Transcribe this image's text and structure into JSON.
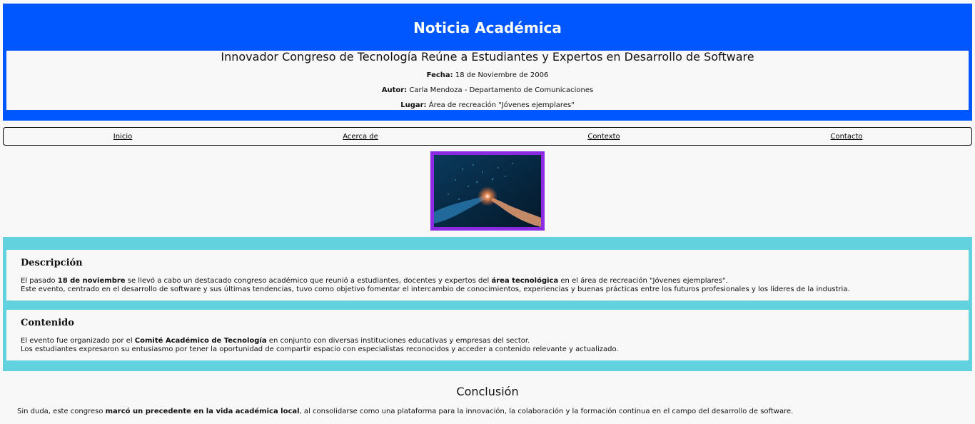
{
  "header": {
    "title": "Noticia Académica",
    "headline": "Innovador Congreso de Tecnología Reúne a Estudiantes y Expertos en Desarrollo de Software",
    "fecha_label": "Fecha:",
    "fecha_value": "18 de Noviembre de 2006",
    "autor_label": "Autor:",
    "autor_value": "Carla Mendoza - Departamento de Comunicaciones",
    "lugar_label": "Lugar:",
    "lugar_value": "Área de recreación \"Jóvenes ejemplares\""
  },
  "nav": {
    "items": [
      "Inicio",
      "Acerca de",
      "Contexto",
      "Contacto"
    ]
  },
  "figure": {
    "icon": "ai-hand-circuit-image"
  },
  "descripcion": {
    "title": "Descripción",
    "p1_a": "El pasado ",
    "p1_b": "18 de noviembre",
    "p1_c": " se llevó a cabo un destacado congreso académico que reunió a estudiantes, docentes y expertos del ",
    "p1_d": "área tecnológica",
    "p1_e": " en el área de recreación \"Jóvenes ejemplares\".",
    "p2": "Este evento, centrado en el desarrollo de software y sus últimas tendencias, tuvo como objetivo fomentar el intercambio de conocimientos, experiencias y buenas prácticas entre los futuros profesionales y los líderes de la industria."
  },
  "contenido": {
    "title": "Contenido",
    "p1_a": "El evento fue organizado por el ",
    "p1_b": "Comité Académico de Tecnología",
    "p1_c": " en conjunto con diversas instituciones educativas y empresas del sector.",
    "p2": "Los estudiantes expresaron su entusiasmo por tener la oportunidad de compartir espacio con especialistas reconocidos y acceder a contenido relevante y actualizado."
  },
  "conclusion": {
    "title": "Conclusión",
    "a": "Sin duda, este congreso ",
    "b": "marcó un precedente en la vida académica local",
    "c": ", al consolidarse como una plataforma para la innovación, la colaboración y la formación continua en el campo del desarrollo de software."
  },
  "colors": {
    "header_bg": "#0057ff",
    "band_bg": "#62d2de",
    "figure_border": "#8a2be2"
  }
}
